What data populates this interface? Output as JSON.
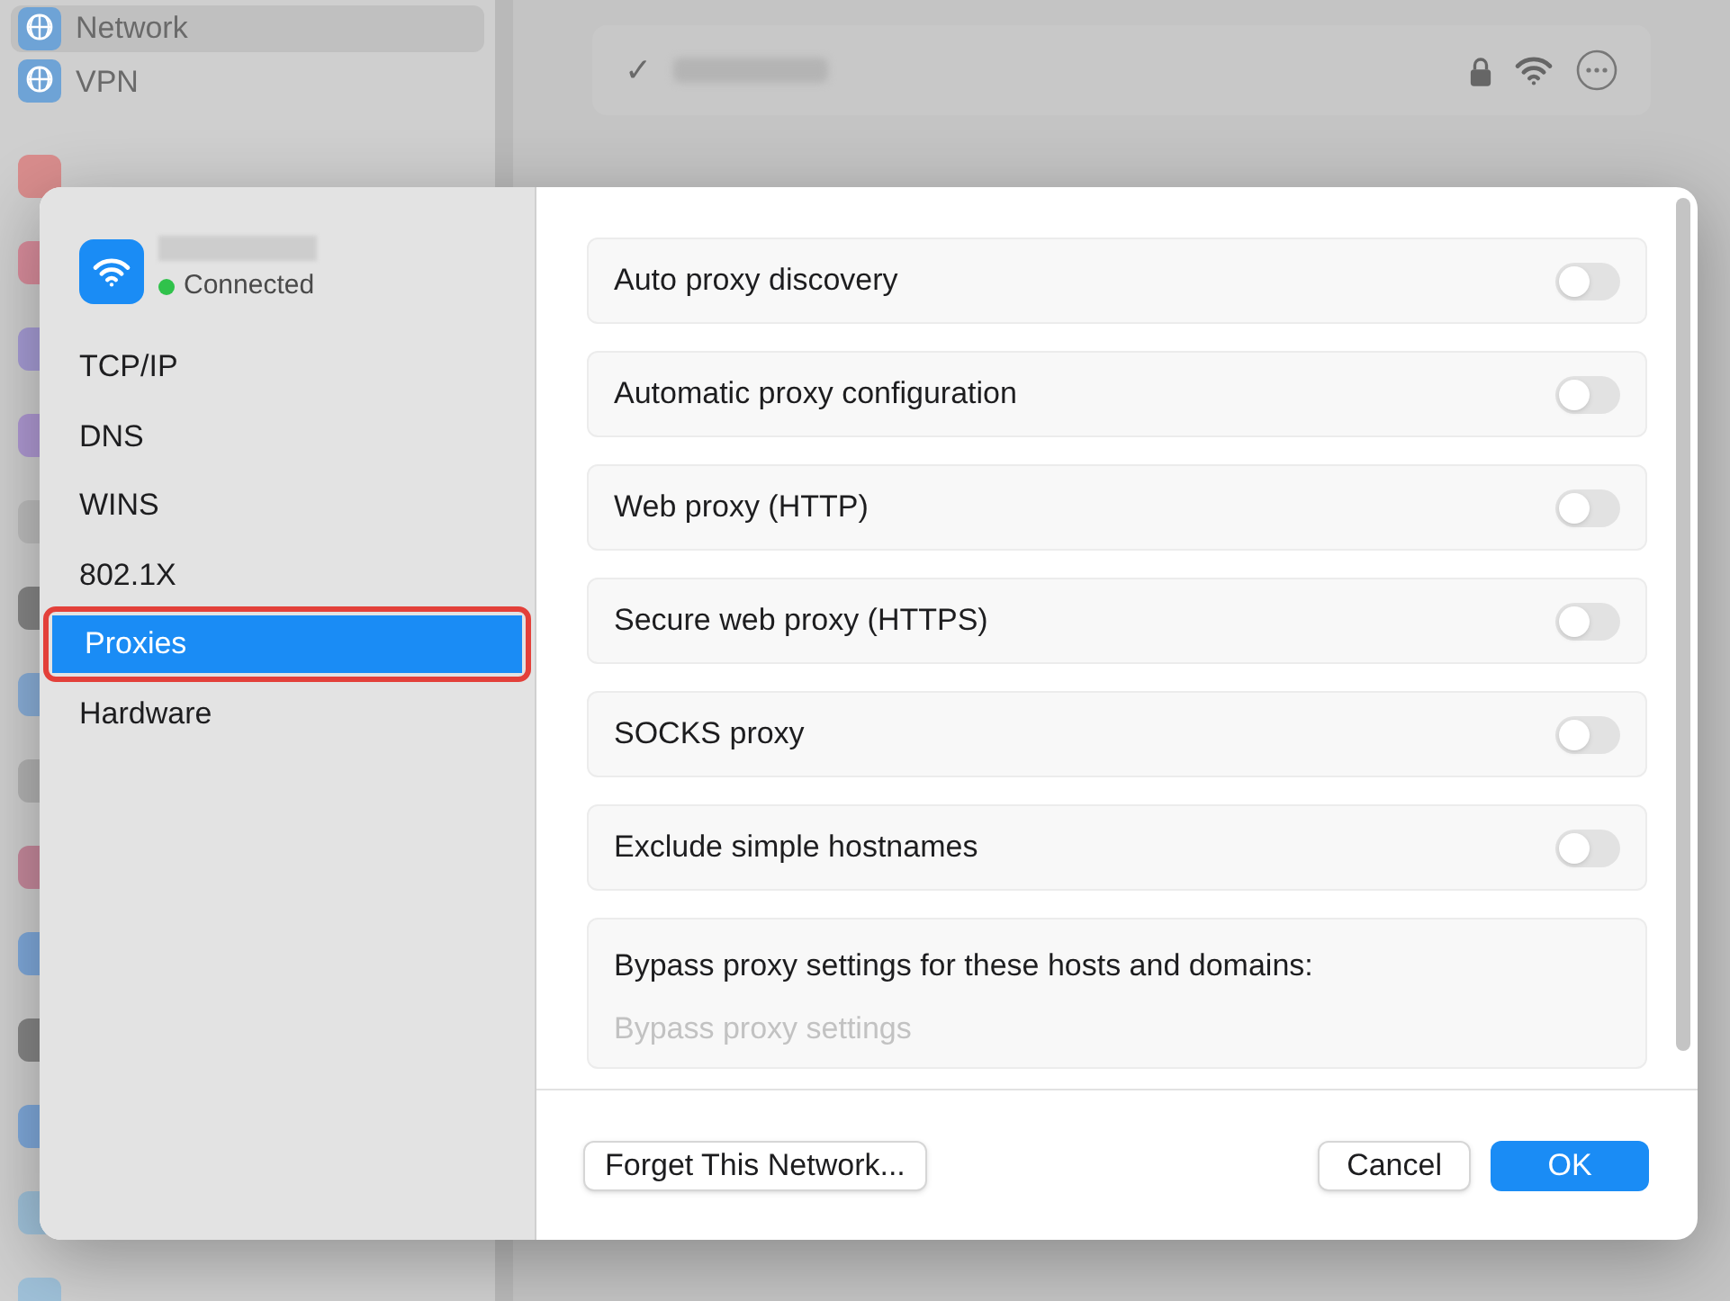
{
  "background": {
    "sidebar_items": [
      {
        "label": "Network",
        "selected": true
      },
      {
        "label": "VPN",
        "selected": false
      }
    ],
    "network_row": {
      "check": "✓"
    }
  },
  "dialog": {
    "header": {
      "status": "Connected",
      "connected": true
    },
    "nav": [
      {
        "label": "TCP/IP",
        "selected": false
      },
      {
        "label": "DNS",
        "selected": false
      },
      {
        "label": "WINS",
        "selected": false
      },
      {
        "label": "802.1X",
        "selected": false
      },
      {
        "label": "Proxies",
        "selected": true,
        "highlighted": true
      },
      {
        "label": "Hardware",
        "selected": false
      }
    ],
    "settings": [
      {
        "label": "Auto proxy discovery",
        "on": false
      },
      {
        "label": "Automatic proxy configuration",
        "on": false
      },
      {
        "label": "Web proxy (HTTP)",
        "on": false
      },
      {
        "label": "Secure web proxy (HTTPS)",
        "on": false
      },
      {
        "label": "SOCKS proxy",
        "on": false
      },
      {
        "label": "Exclude simple hostnames",
        "on": false
      }
    ],
    "bypass": {
      "label": "Bypass proxy settings for these hosts and domains:",
      "placeholder": "Bypass proxy settings"
    },
    "buttons": {
      "forget": "Forget This Network...",
      "cancel": "Cancel",
      "ok": "OK"
    }
  }
}
